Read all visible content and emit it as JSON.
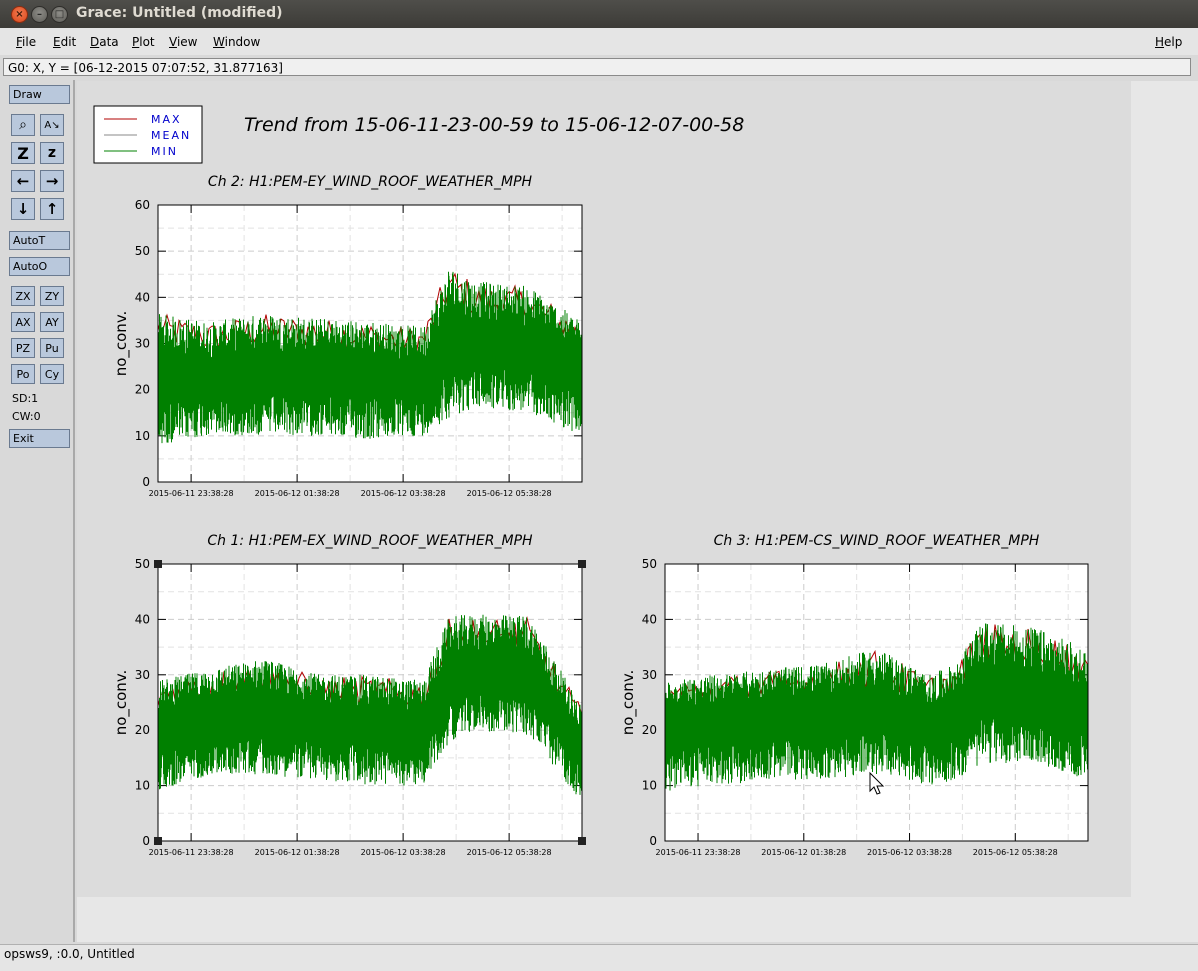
{
  "window": {
    "title": "Grace: Untitled (modified)",
    "close_glyph": "×",
    "minimize_glyph": "–",
    "maximize_glyph": "□"
  },
  "menu": {
    "items": [
      "File",
      "Edit",
      "Data",
      "Plot",
      "View",
      "Window"
    ],
    "help": "Help"
  },
  "locator": "G0: X, Y = [06-12-2015 07:07:52, 31.877163]",
  "toolbox": {
    "draw": "Draw",
    "zoom_glyph": "⌕",
    "autoscale_glyph": "A↘",
    "zoom_x_glyph": "Z",
    "zoom_y_glyph": "z",
    "left_glyph": "←",
    "right_glyph": "→",
    "down_glyph": "↓",
    "up_glyph": "↑",
    "autot": "AutoT",
    "autoo": "AutoO",
    "grid": [
      "ZX",
      "ZY",
      "AX",
      "AY",
      "PZ",
      "Pu",
      "Po",
      "Cy"
    ],
    "sd": "SD:1",
    "cw": "CW:0",
    "exit": "Exit"
  },
  "status": "opsws9, :0.0, Untitled",
  "colors": {
    "max": "#b00000",
    "mean": "#8a8a8a",
    "min": "#008000",
    "legend_text": "#0000cc"
  },
  "legend": [
    "MAX",
    "MEAN",
    "MIN"
  ],
  "page_title": "Trend from 15-06-11-23-00-59 to 15-06-12-07-00-58",
  "chart_data": [
    {
      "type": "line",
      "title": "Ch 2: H1:PEM-EY_WIND_ROOF_WEATHER_MPH",
      "ylabel": "no_conv.",
      "xlabel": "",
      "ylim": [
        0,
        60
      ],
      "yticks": [
        0,
        10,
        20,
        30,
        40,
        50,
        60
      ],
      "xlim": [
        "2015-06-11 23:00:59",
        "2015-06-12 07:00:58"
      ],
      "xticks": [
        "2015-06-11 23:38:28",
        "2015-06-12 01:38:28",
        "2015-06-12 03:38:28",
        "2015-06-12 05:38:28"
      ],
      "grid": true,
      "series": [
        {
          "name": "MAX",
          "x": [
            "2015-06-11 23:00:59",
            "2015-06-12 00:00:59",
            "2015-06-12 01:00:59",
            "2015-06-12 02:00:59",
            "2015-06-12 03:00:59",
            "2015-06-12 04:00:59",
            "2015-06-12 04:30:59",
            "2015-06-12 05:00:59",
            "2015-06-12 06:00:59",
            "2015-06-12 07:00:58"
          ],
          "values": [
            38,
            36,
            38,
            37,
            36,
            35,
            49,
            45,
            44,
            36
          ]
        },
        {
          "name": "MEAN",
          "x": [
            "2015-06-11 23:00:59",
            "2015-06-12 00:00:59",
            "2015-06-12 01:00:59",
            "2015-06-12 02:00:59",
            "2015-06-12 03:00:59",
            "2015-06-12 04:00:59",
            "2015-06-12 04:30:59",
            "2015-06-12 05:00:59",
            "2015-06-12 06:00:59",
            "2015-06-12 07:00:58"
          ],
          "values": [
            23,
            23,
            24,
            23,
            24,
            22,
            30,
            30,
            29,
            24
          ]
        },
        {
          "name": "MIN",
          "x": [
            "2015-06-11 23:00:59",
            "2015-06-12 00:00:59",
            "2015-06-12 01:00:59",
            "2015-06-12 02:00:59",
            "2015-06-12 03:00:59",
            "2015-06-12 04:00:59",
            "2015-06-12 04:30:59",
            "2015-06-12 05:00:59",
            "2015-06-12 06:00:59",
            "2015-06-12 07:00:58"
          ],
          "values": [
            8,
            10,
            10,
            10,
            9,
            10,
            14,
            16,
            15,
            10
          ]
        }
      ]
    },
    {
      "type": "line",
      "title": "Ch 1: H1:PEM-EX_WIND_ROOF_WEATHER_MPH",
      "ylabel": "no_conv.",
      "xlabel": "",
      "ylim": [
        0,
        50
      ],
      "yticks": [
        0,
        10,
        20,
        30,
        40,
        50
      ],
      "xlim": [
        "2015-06-11 23:00:59",
        "2015-06-12 07:00:58"
      ],
      "xticks": [
        "2015-06-11 23:38:28",
        "2015-06-12 01:38:28",
        "2015-06-12 03:38:28",
        "2015-06-12 05:38:28"
      ],
      "grid": true,
      "series": [
        {
          "name": "MAX",
          "x": [
            "2015-06-11 23:00:59",
            "2015-06-12 00:00:59",
            "2015-06-12 01:00:59",
            "2015-06-12 02:00:59",
            "2015-06-12 03:00:59",
            "2015-06-12 04:00:59",
            "2015-06-12 04:30:59",
            "2015-06-12 05:00:59",
            "2015-06-12 06:00:59",
            "2015-06-12 07:00:58"
          ],
          "values": [
            30,
            32,
            34,
            31,
            31,
            30,
            42,
            42,
            42,
            25
          ]
        },
        {
          "name": "MEAN",
          "x": [
            "2015-06-11 23:00:59",
            "2015-06-12 00:00:59",
            "2015-06-12 01:00:59",
            "2015-06-12 02:00:59",
            "2015-06-12 03:00:59",
            "2015-06-12 04:00:59",
            "2015-06-12 04:30:59",
            "2015-06-12 05:00:59",
            "2015-06-12 06:00:59",
            "2015-06-12 07:00:58"
          ],
          "values": [
            20,
            23,
            24,
            22,
            21,
            20,
            29,
            31,
            30,
            17
          ]
        },
        {
          "name": "MIN",
          "x": [
            "2015-06-11 23:00:59",
            "2015-06-12 00:00:59",
            "2015-06-12 01:00:59",
            "2015-06-12 02:00:59",
            "2015-06-12 03:00:59",
            "2015-06-12 04:00:59",
            "2015-06-12 04:30:59",
            "2015-06-12 05:00:59",
            "2015-06-12 06:00:59",
            "2015-06-12 07:00:58"
          ],
          "values": [
            9,
            12,
            12,
            11,
            10,
            10,
            18,
            20,
            19,
            7
          ]
        }
      ]
    },
    {
      "type": "line",
      "title": "Ch 3: H1:PEM-CS_WIND_ROOF_WEATHER_MPH",
      "ylabel": "no_conv.",
      "xlabel": "",
      "ylim": [
        0,
        50
      ],
      "yticks": [
        0,
        10,
        20,
        30,
        40,
        50
      ],
      "xlim": [
        "2015-06-11 23:00:59",
        "2015-06-12 07:00:58"
      ],
      "xticks": [
        "2015-06-11 23:38:28",
        "2015-06-12 01:38:28",
        "2015-06-12 03:38:28",
        "2015-06-12 05:38:28"
      ],
      "grid": true,
      "series": [
        {
          "name": "MAX",
          "x": [
            "2015-06-11 23:00:59",
            "2015-06-12 00:00:59",
            "2015-06-12 01:00:59",
            "2015-06-12 02:00:59",
            "2015-06-12 03:00:59",
            "2015-06-12 04:00:59",
            "2015-06-12 04:30:59",
            "2015-06-12 05:00:59",
            "2015-06-12 06:00:59",
            "2015-06-12 07:00:58"
          ],
          "values": [
            30,
            31,
            32,
            33,
            36,
            31,
            33,
            41,
            40,
            36
          ]
        },
        {
          "name": "MEAN",
          "x": [
            "2015-06-11 23:00:59",
            "2015-06-12 00:00:59",
            "2015-06-12 01:00:59",
            "2015-06-12 02:00:59",
            "2015-06-12 03:00:59",
            "2015-06-12 04:00:59",
            "2015-06-12 04:30:59",
            "2015-06-12 05:00:59",
            "2015-06-12 06:00:59",
            "2015-06-12 07:00:58"
          ],
          "values": [
            21,
            22,
            23,
            23,
            24,
            21,
            23,
            27,
            26,
            23
          ]
        },
        {
          "name": "MIN",
          "x": [
            "2015-06-11 23:00:59",
            "2015-06-12 00:00:59",
            "2015-06-12 01:00:59",
            "2015-06-12 02:00:59",
            "2015-06-12 03:00:59",
            "2015-06-12 04:00:59",
            "2015-06-12 04:30:59",
            "2015-06-12 05:00:59",
            "2015-06-12 06:00:59",
            "2015-06-12 07:00:58"
          ],
          "values": [
            9,
            10,
            11,
            11,
            12,
            10,
            11,
            14,
            14,
            11
          ]
        }
      ]
    }
  ]
}
